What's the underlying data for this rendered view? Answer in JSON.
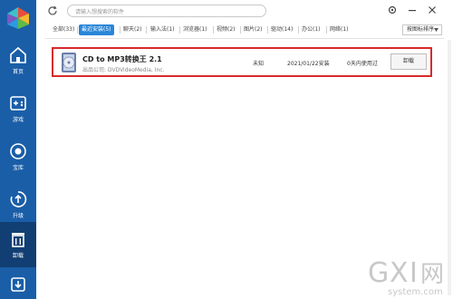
{
  "search": {
    "placeholder": "请输入想搜索的软件"
  },
  "sidebar": {
    "items": [
      {
        "label": "首页",
        "icon": "home-icon"
      },
      {
        "label": "游戏",
        "icon": "gamepad-icon"
      },
      {
        "label": "宝库",
        "icon": "treasure-icon"
      },
      {
        "label": "升级",
        "icon": "upgrade-icon"
      },
      {
        "label": "卸载",
        "icon": "trash-icon"
      },
      {
        "label": "",
        "icon": "download-icon"
      }
    ]
  },
  "tabs": [
    {
      "label": "全部(33)"
    },
    {
      "label": "最近安装(5)"
    },
    {
      "label": "聊天(2)"
    },
    {
      "label": "输入法(1)"
    },
    {
      "label": "浏览器(1)"
    },
    {
      "label": "视频(2)"
    },
    {
      "label": "图片(2)"
    },
    {
      "label": "驱动(14)"
    },
    {
      "label": "办公(1)"
    },
    {
      "label": "网络(1)"
    }
  ],
  "sort": {
    "label": "按图标排序"
  },
  "app": {
    "name": "CD to MP3转换王 2.1",
    "publisher": "出品公司: DVDVideoMedia, Inc.",
    "size": "未知",
    "date": "2021/01/22安装",
    "usage": "0天内使用过",
    "uninstall_label": "卸载"
  },
  "watermark": {
    "text": "GXI网",
    "sub": "system.com"
  },
  "colors": {
    "sidebar": "#1a5ea8",
    "accent": "#2a86d8",
    "highlight": "#d82a2a"
  }
}
